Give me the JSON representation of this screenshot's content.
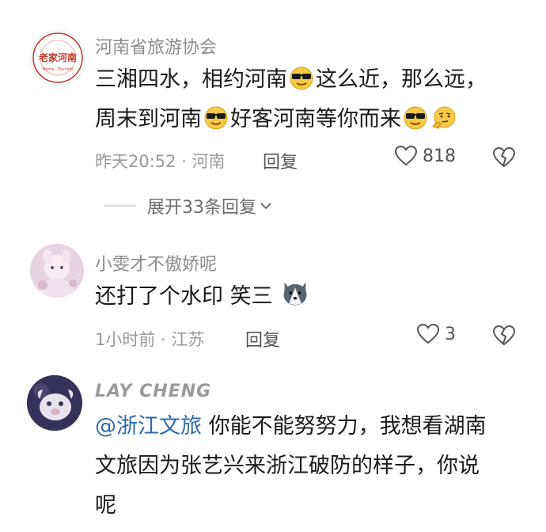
{
  "comments": [
    {
      "username": "河南省旅游协会",
      "avatar_text": "老家河南",
      "text_line1_a": "三湘四水，相约河南",
      "text_line1_b": "这么近，那么远，",
      "text_line2_a": "周末到河南",
      "text_line2_b": "好客河南等你而来",
      "time": "昨天20:52 · 河南",
      "reply_label": "回复",
      "likes": "818",
      "expand_label": "展开33条回复"
    },
    {
      "username": "小雯才不傲娇呢",
      "text": "还打了个水印 笑三",
      "time": "1小时前 · 江苏",
      "reply_label": "回复",
      "likes": "3"
    },
    {
      "username": "LAY CHENG",
      "mention": "@浙江文旅",
      "text_line1": " 你能不能努努力，我想看湖南",
      "text_line2": "文旅因为张艺兴来浙江破防的样子，你说",
      "text_line3": "呢"
    }
  ],
  "icons": {
    "emoji_sunglasses": "sunglasses-face",
    "emoji_thinking": "thinking-face",
    "emoji_husky": "husky-face",
    "like": "heart-outline",
    "dislike": "broken-heart",
    "expand": "chevron-down"
  }
}
